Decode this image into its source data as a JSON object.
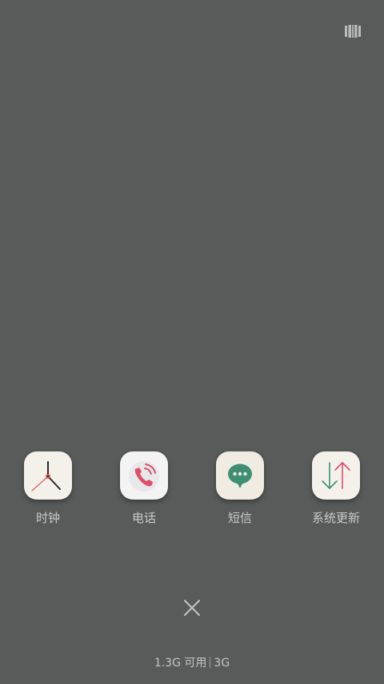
{
  "colors": {
    "background": "#585b5a",
    "label": "#c9cbca",
    "clock_bg": "#f4f1ea",
    "phone_bg": "#f3f3f3",
    "phone_accent": "#e04c6b",
    "sms_bg": "#f1ece2",
    "sms_bubble": "#3e8f72",
    "update_green": "#3e8f72",
    "update_pink": "#e04c6b"
  },
  "toolbar": {
    "manager_icon": "multitask-manager-icon"
  },
  "apps": [
    {
      "label": "时钟",
      "icon": "clock-icon"
    },
    {
      "label": "电话",
      "icon": "phone-icon"
    },
    {
      "label": "短信",
      "icon": "message-icon"
    },
    {
      "label": "系统更新",
      "icon": "system-update-icon"
    }
  ],
  "close": {
    "icon": "close-icon"
  },
  "memory": {
    "available": "1.3G 可用",
    "total": "3G"
  }
}
